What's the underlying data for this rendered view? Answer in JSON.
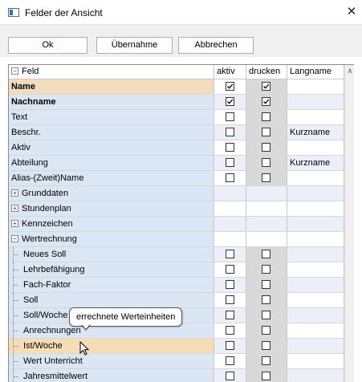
{
  "window": {
    "title": "Felder der Ansicht",
    "close_glyph": "✕"
  },
  "buttons": {
    "ok": "Ok",
    "uebernahme": "Übernahme",
    "abbrechen": "Abbrechen"
  },
  "columns": {
    "feld": "Feld",
    "aktiv": "aktiv",
    "drucken": "drucken",
    "langname": "Langname"
  },
  "rows": [
    {
      "label": "Name",
      "aktiv": true,
      "drucken": true,
      "langname": "",
      "kind": "field",
      "style": "selected"
    },
    {
      "label": "Nachname",
      "aktiv": true,
      "drucken": true,
      "langname": "",
      "kind": "field",
      "style": "bold"
    },
    {
      "label": "Text",
      "aktiv": false,
      "drucken": false,
      "langname": "",
      "kind": "field"
    },
    {
      "label": "Beschr.",
      "aktiv": false,
      "drucken": false,
      "langname": "Kurzname",
      "kind": "field"
    },
    {
      "label": "Aktiv",
      "aktiv": false,
      "drucken": false,
      "langname": "",
      "kind": "field"
    },
    {
      "label": "Abteilung",
      "aktiv": false,
      "drucken": false,
      "langname": "Kurzname",
      "kind": "field"
    },
    {
      "label": "Alias-(Zweit)Name",
      "aktiv": false,
      "drucken": false,
      "langname": "",
      "kind": "field"
    },
    {
      "label": "Grunddaten",
      "kind": "group",
      "expanded": false
    },
    {
      "label": "Stundenplan",
      "kind": "group",
      "expanded": false
    },
    {
      "label": "Kennzeichen",
      "kind": "group",
      "expanded": false
    },
    {
      "label": "Wertrechnung",
      "kind": "group",
      "expanded": true
    },
    {
      "label": "Neues Soll",
      "aktiv": false,
      "drucken": false,
      "langname": "",
      "kind": "child"
    },
    {
      "label": "Lehrbefähigung",
      "aktiv": false,
      "drucken": false,
      "langname": "",
      "kind": "child"
    },
    {
      "label": "Fach-Faktor",
      "aktiv": false,
      "drucken": false,
      "langname": "",
      "kind": "child"
    },
    {
      "label": "Soll",
      "aktiv": false,
      "drucken": false,
      "langname": "",
      "kind": "child"
    },
    {
      "label": "Soll/Woche",
      "aktiv": false,
      "drucken": false,
      "langname": "",
      "kind": "child"
    },
    {
      "label": "Anrechnungen",
      "aktiv": false,
      "drucken": false,
      "langname": "",
      "kind": "child"
    },
    {
      "label": "Ist/Woche",
      "aktiv": false,
      "drucken": false,
      "langname": "",
      "kind": "child",
      "style": "current"
    },
    {
      "label": "Wert Unterricht",
      "aktiv": false,
      "drucken": false,
      "langname": "",
      "kind": "child"
    },
    {
      "label": "Jahresmittelwert",
      "aktiv": false,
      "drucken": false,
      "langname": "",
      "kind": "child"
    }
  ],
  "tooltip": "errechnete Werteinheiten",
  "icons": {
    "collapse": "−",
    "expand": "+",
    "scroll_up": "∧"
  }
}
